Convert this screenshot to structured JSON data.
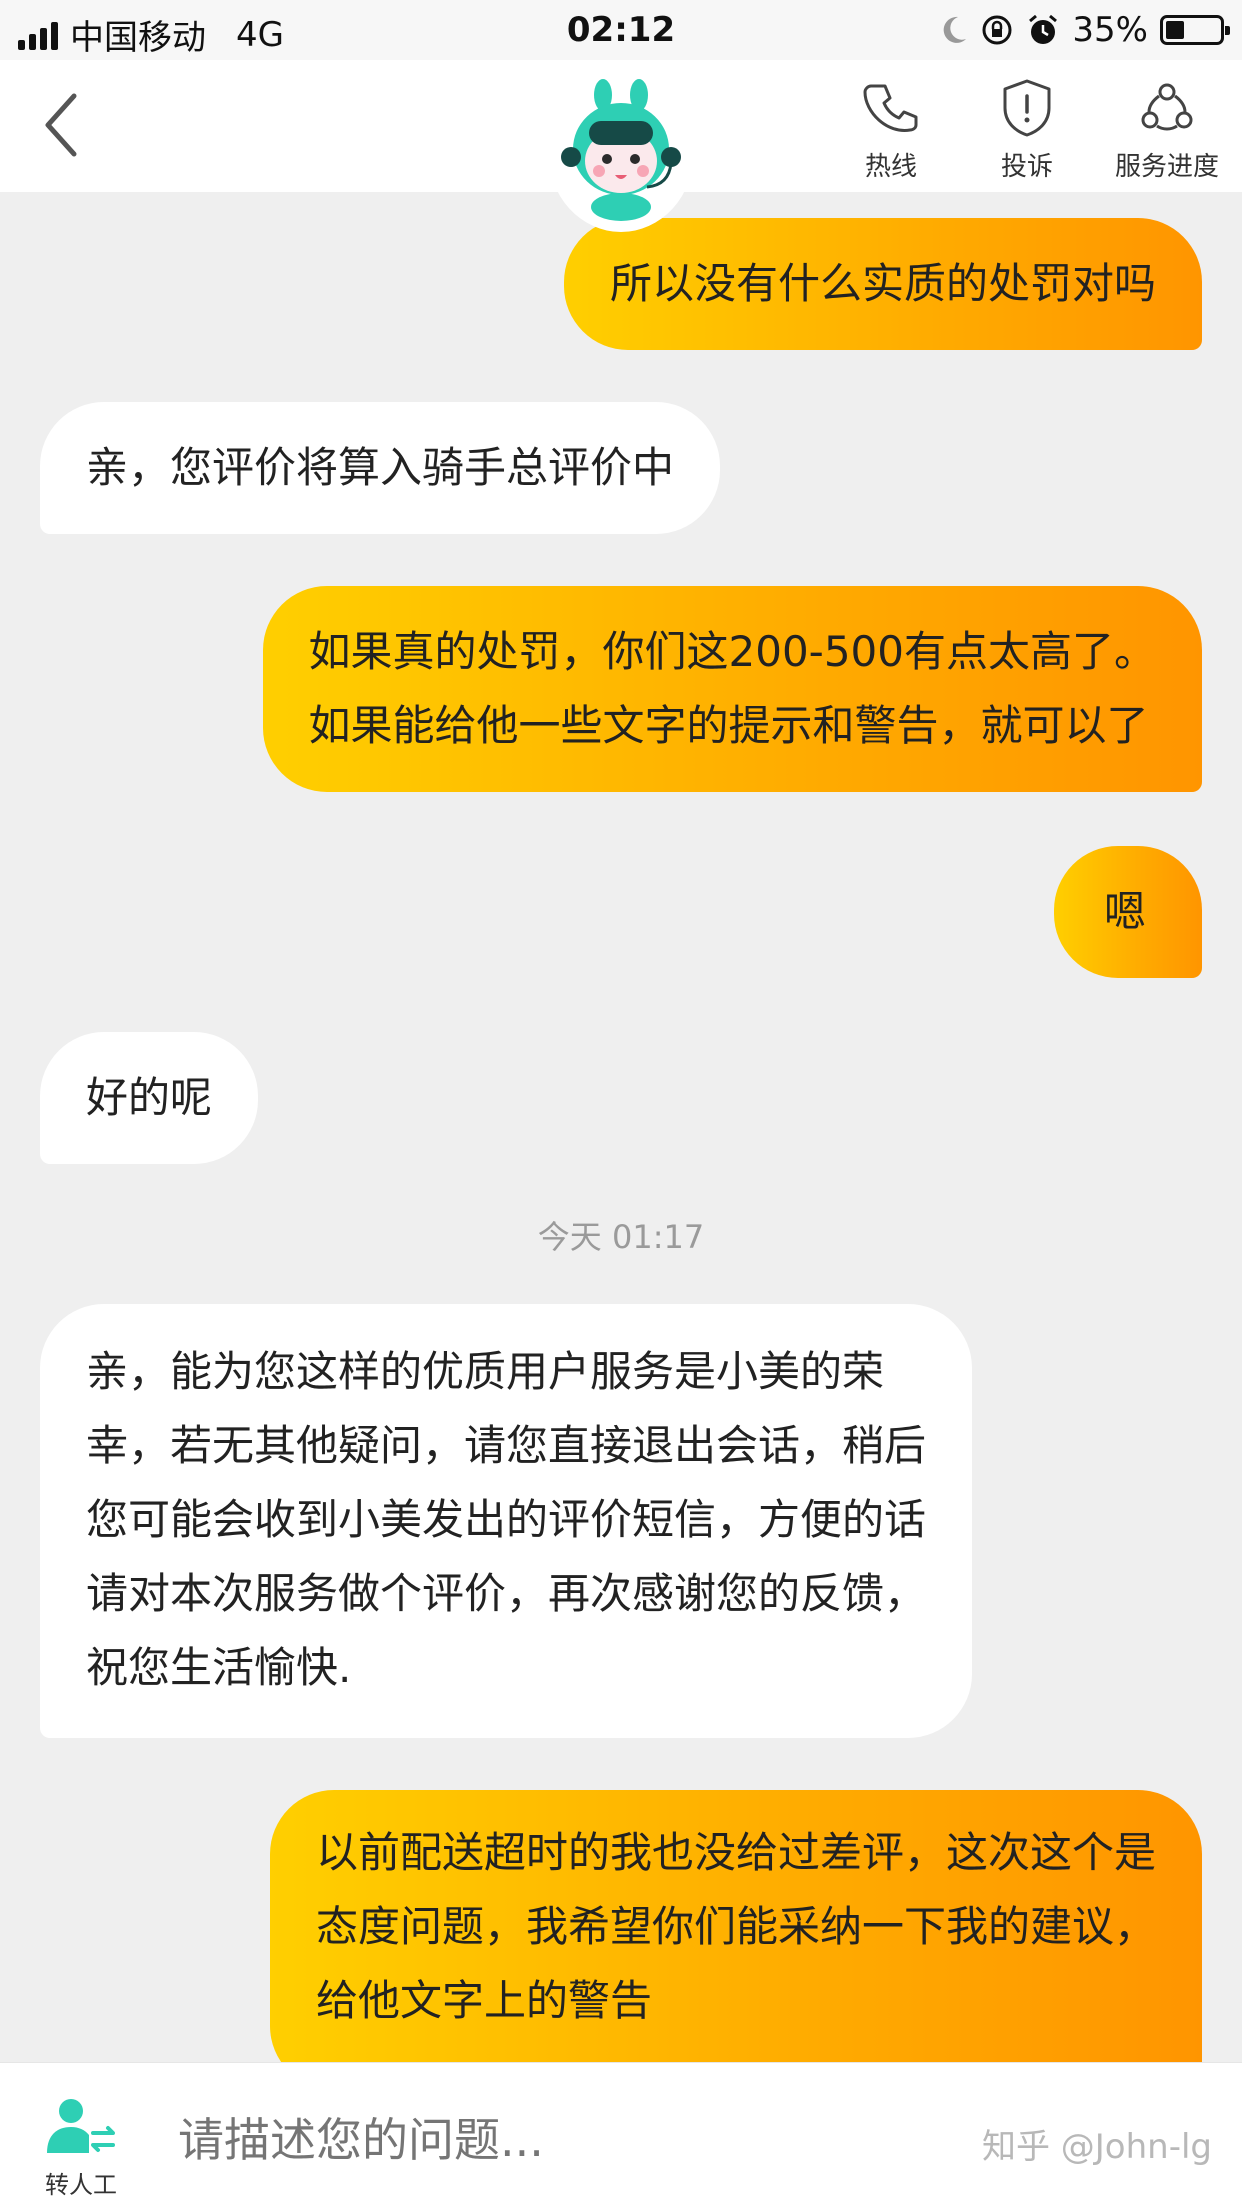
{
  "status_bar": {
    "carrier": "中国移动",
    "network": "4G",
    "time": "02:12",
    "battery": "35%"
  },
  "nav": {
    "hotline_label": "热线",
    "complaint_label": "投诉",
    "progress_label": "服务进度"
  },
  "messages": [
    {
      "from": "user",
      "lines": [
        "所以没有什么实质的处罚对吗"
      ]
    },
    {
      "from": "bot",
      "lines": [
        "亲，您评价将算入骑手总评价中"
      ]
    },
    {
      "from": "user",
      "lines": [
        "如果真的处罚，你们这200-500有点太高了。",
        "如果能给他一些文字的提示和警告，就可以了"
      ]
    },
    {
      "from": "user",
      "lines": [
        "嗯"
      ]
    },
    {
      "from": "bot",
      "lines": [
        "好的呢"
      ]
    },
    {
      "from": "bot",
      "lines": [
        "亲，能为您这样的优质用户服务是小美的荣",
        "幸，若无其他疑问，请您直接退出会话，稍后",
        "您可能会收到小美发出的评价短信，方便的话",
        "请对本次服务做个评价，再次感谢您的反馈，",
        "祝您生活愉快."
      ]
    },
    {
      "from": "user",
      "lines": [
        "以前配送超时的我也没给过差评，这次这个是",
        "态度问题，我希望你们能采纳一下我的建议，",
        "给他文字上的警告"
      ]
    }
  ],
  "timestamp": "今天 01:17",
  "input": {
    "transfer_label": "转人工",
    "placeholder": "请描述您的问题..."
  },
  "watermark": "知乎 @John-lg",
  "colors": {
    "user_bubble_start": "#ffcf00",
    "user_bubble_end": "#ff9500",
    "bot_bubble": "#ffffff",
    "accent_teal": "#2ecfb4"
  }
}
